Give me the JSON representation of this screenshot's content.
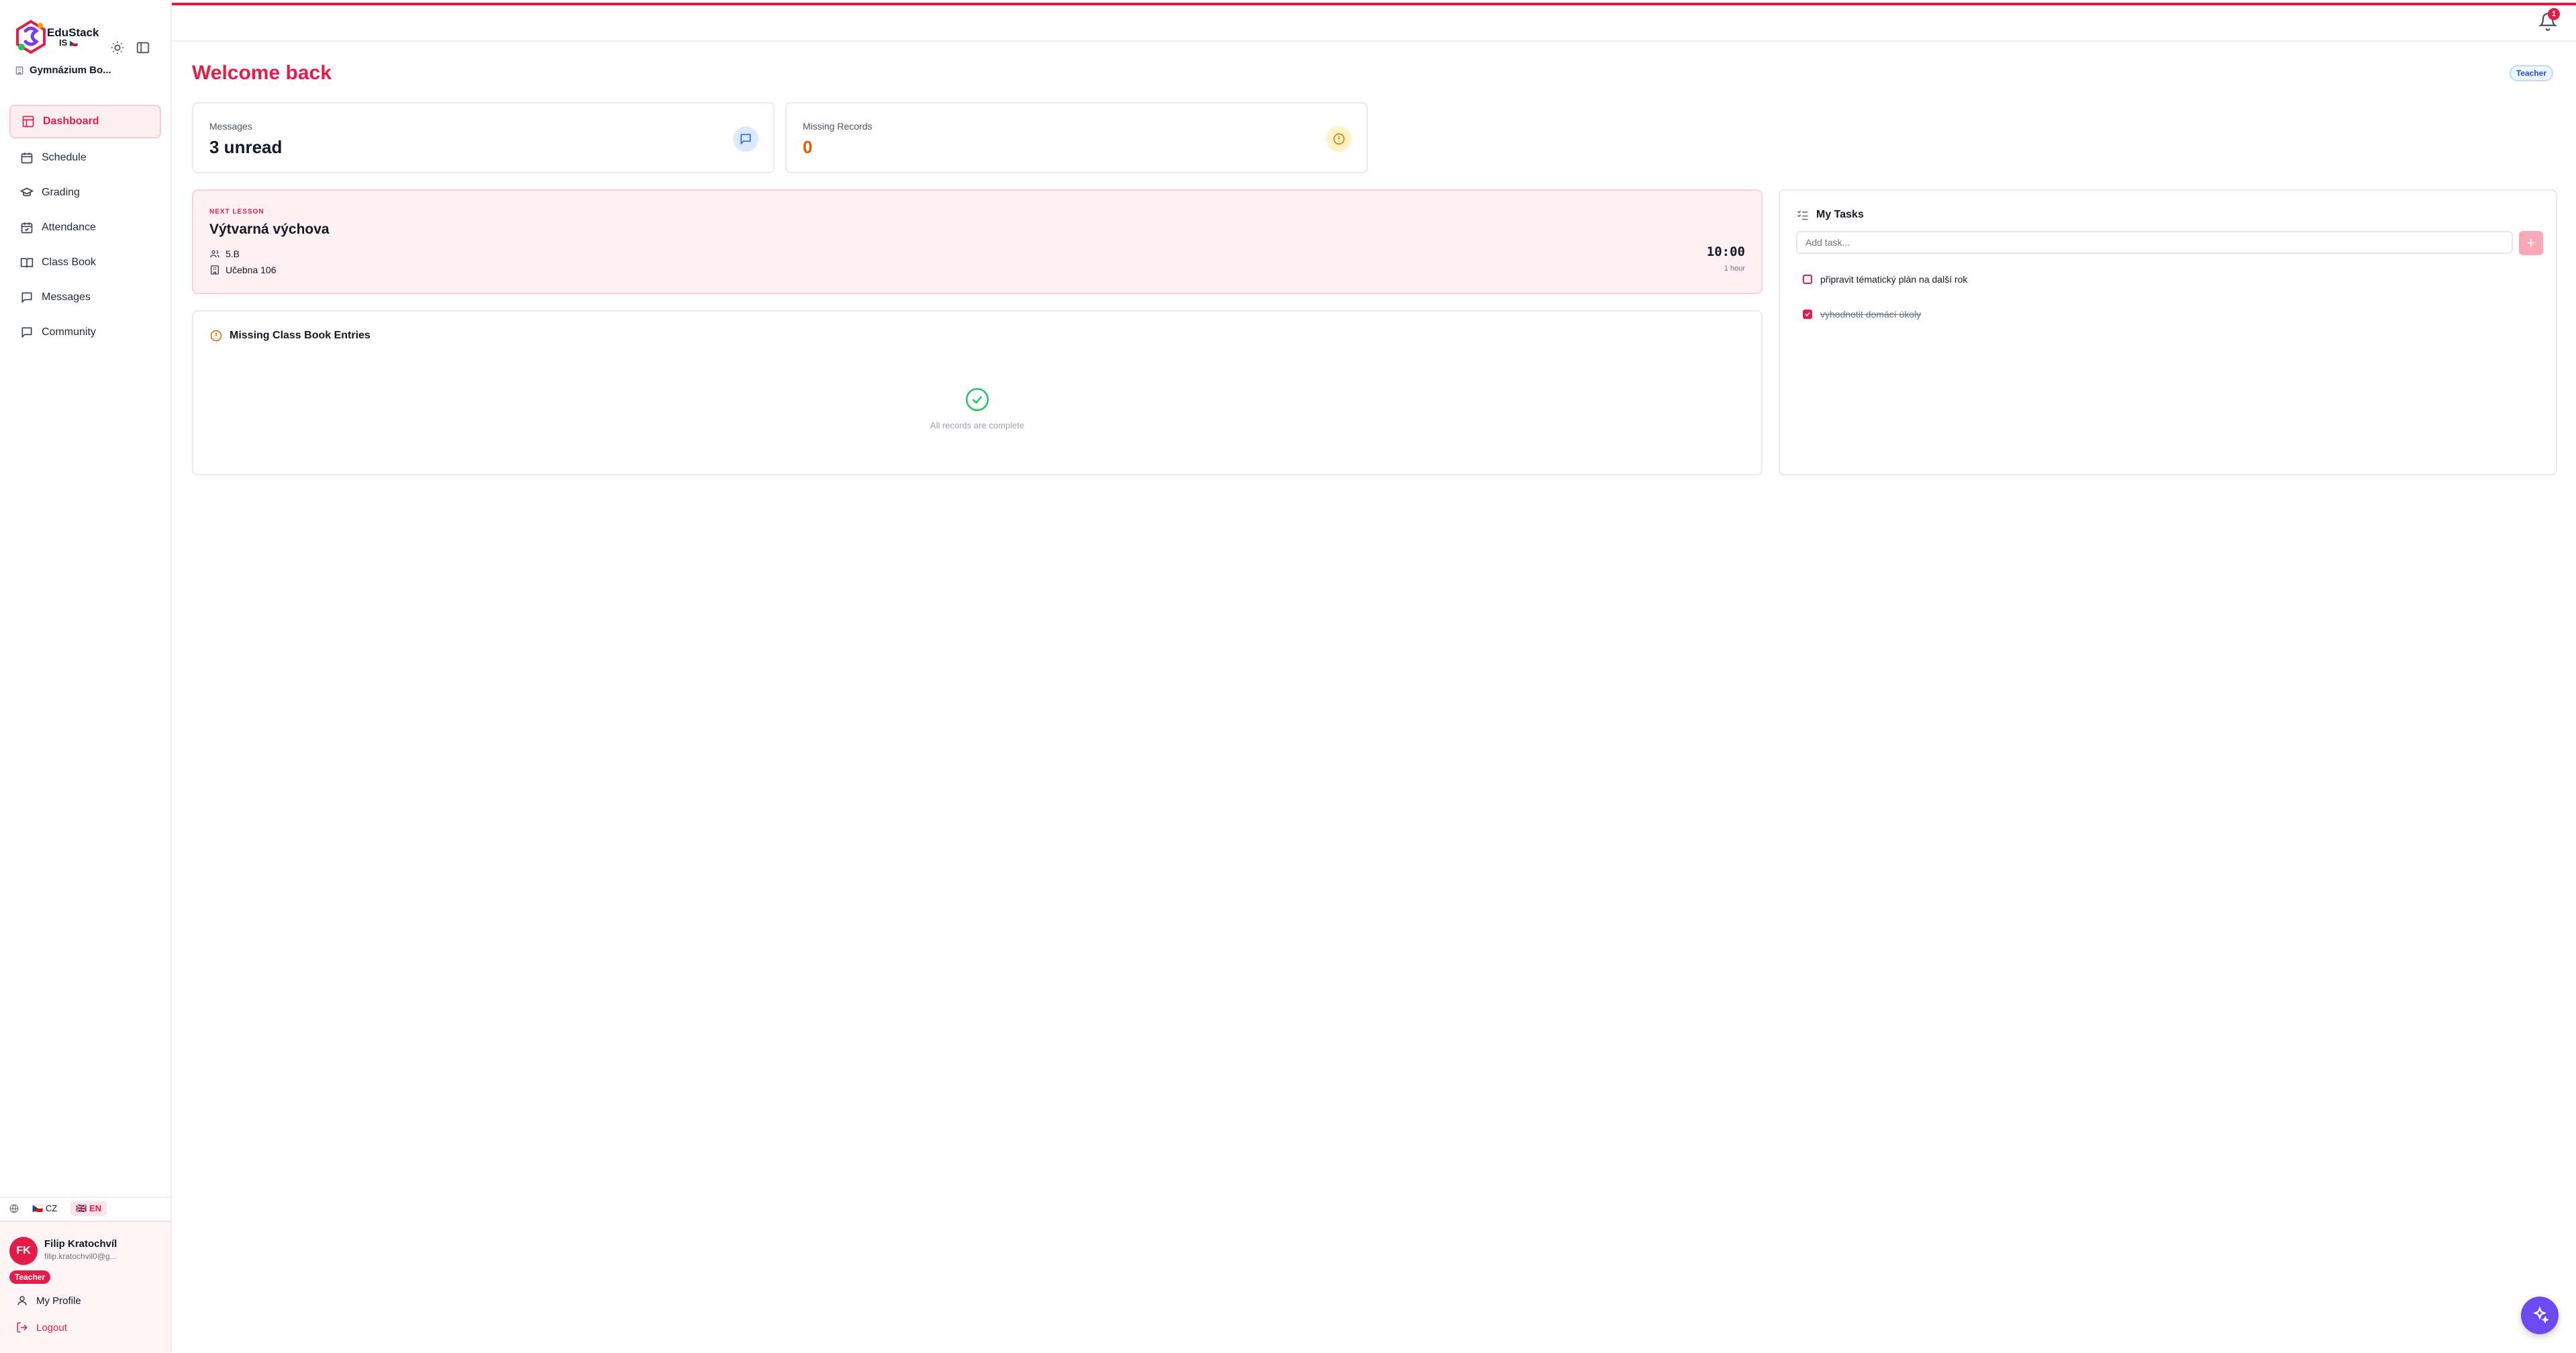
{
  "brand": {
    "name": "EduStack",
    "sub": "IS",
    "flag": "🇨🇿"
  },
  "school": {
    "name": "Gymnázium Bo..."
  },
  "sidebar": {
    "items": [
      {
        "label": "Dashboard",
        "icon": "dashboard-icon",
        "active": true
      },
      {
        "label": "Schedule",
        "icon": "calendar-icon"
      },
      {
        "label": "Grading",
        "icon": "graduation-cap-icon"
      },
      {
        "label": "Attendance",
        "icon": "calendar-check-icon"
      },
      {
        "label": "Class Book",
        "icon": "book-open-icon"
      },
      {
        "label": "Messages",
        "icon": "message-icon"
      },
      {
        "label": "Community",
        "icon": "message-icon"
      }
    ],
    "languages": [
      {
        "flag": "🇨🇿",
        "code": "CZ"
      },
      {
        "flag": "🇬🇧",
        "code": "EN",
        "active": true
      }
    ]
  },
  "user": {
    "initials": "FK",
    "name": "Filip Kratochvíl",
    "email": "filip.kratochvil0@g...",
    "role": "Teacher",
    "profile_label": "My Profile",
    "logout_label": "Logout"
  },
  "header": {
    "notifications": "1"
  },
  "main": {
    "welcome": "Welcome back",
    "role_tag": "Teacher",
    "stats": [
      {
        "label": "Messages",
        "value": "3 unread",
        "icon": "message-icon",
        "color": "#2563eb"
      },
      {
        "label": "Missing Records",
        "value": "0",
        "icon": "alert-circle-icon",
        "color": "#d97706"
      }
    ],
    "next_lesson": {
      "kicker": "NEXT LESSON",
      "subject": "Výtvarná výchova",
      "class": "5.B",
      "room": "Učebna 106",
      "time": "10:00",
      "duration": "1 hour"
    },
    "missing_entries": {
      "title": "Missing Class Book Entries",
      "empty": "All records are complete"
    },
    "tasks": {
      "title": "My Tasks",
      "placeholder": "Add task...",
      "items": [
        {
          "text": "připravit tématický plán na další rok",
          "done": false
        },
        {
          "text": "vyhodnotit domácí úkoly",
          "done": true
        }
      ]
    }
  },
  "colors": {
    "accent": "#e11d48",
    "fab": "#6d4af0"
  }
}
